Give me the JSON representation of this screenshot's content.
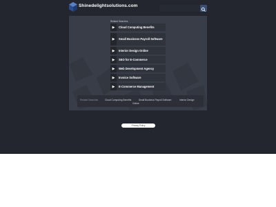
{
  "header": {
    "site_title": "Shinedelightsolutions.com",
    "search_placeholder": "",
    "logo_icon": "cube-logo-icon",
    "search_icon": "search-icon"
  },
  "related": {
    "label": "Related Searches",
    "items": [
      {
        "label": "Cloud Computing Benefits"
      },
      {
        "label": "Small Business Payroll Software"
      },
      {
        "label": "Interior Design Online"
      },
      {
        "label": "SEO for E-Commerce"
      },
      {
        "label": "Web Development Agency"
      },
      {
        "label": "Invoice Software"
      },
      {
        "label": "E-Commerce Management"
      }
    ],
    "arrow_icon": "chevron-right-icon"
  },
  "footer_links": [
    {
      "label": "Related Searches"
    },
    {
      "label": "Cloud Computing Benefits"
    },
    {
      "label": "Small Business Payroll Software"
    },
    {
      "label": "Interior Design"
    },
    {
      "label": "Online"
    }
  ],
  "privacy": {
    "label": "Privacy Policy"
  },
  "colors": {
    "background": "#23262e",
    "panel": "#393d47",
    "link_bg": "#2f333c",
    "accent": "#3b4f73"
  }
}
